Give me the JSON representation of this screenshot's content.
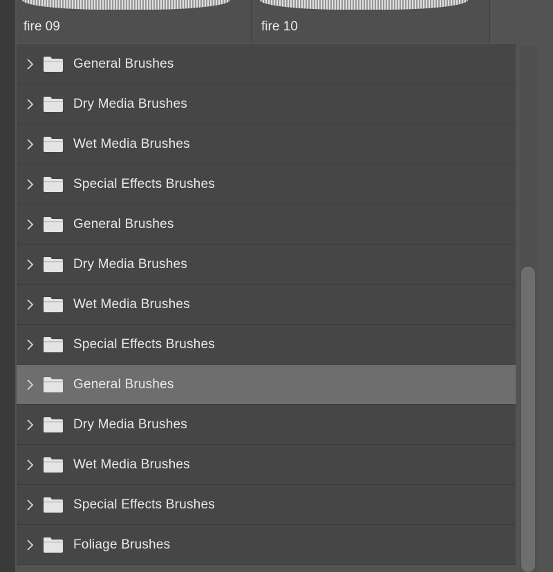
{
  "thumbnails": [
    {
      "label": "fire 09"
    },
    {
      "label": "fire 10"
    }
  ],
  "folders": [
    {
      "label": "General Brushes",
      "selected": false
    },
    {
      "label": "Dry Media Brushes",
      "selected": false
    },
    {
      "label": "Wet Media Brushes",
      "selected": false
    },
    {
      "label": "Special Effects Brushes",
      "selected": false
    },
    {
      "label": "General Brushes",
      "selected": false
    },
    {
      "label": "Dry Media Brushes",
      "selected": false
    },
    {
      "label": "Wet Media Brushes",
      "selected": false
    },
    {
      "label": "Special Effects Brushes",
      "selected": false
    },
    {
      "label": "General Brushes",
      "selected": true
    },
    {
      "label": "Dry Media Brushes",
      "selected": false
    },
    {
      "label": "Wet Media Brushes",
      "selected": false
    },
    {
      "label": "Special Effects Brushes",
      "selected": false
    },
    {
      "label": "Foliage Brushes",
      "selected": false
    }
  ],
  "colors": {
    "panel_bg": "#535353",
    "row_bg": "#464646",
    "row_selected_bg": "#6e6e6e",
    "text": "#e9e9e9"
  }
}
